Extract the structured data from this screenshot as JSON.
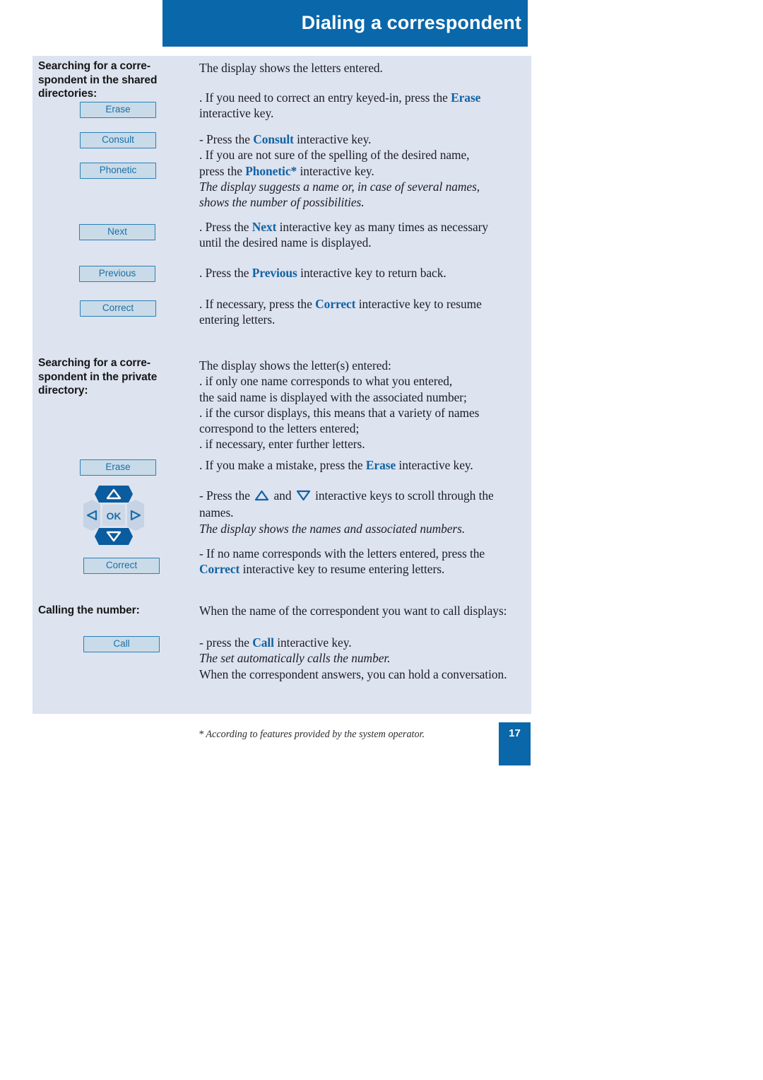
{
  "header": {
    "title": "Dialing a correspondent"
  },
  "sections": [
    {
      "id": "shared",
      "heading": "Searching for a corre-\nspondent in the shared\ndirectories:",
      "softkeys": [
        {
          "label": "Erase"
        },
        {
          "label": "Consult"
        },
        {
          "label": "Phonetic"
        },
        {
          "label": "Next"
        },
        {
          "label": "Previous"
        },
        {
          "label": "Correct"
        }
      ],
      "paragraphs": [
        {
          "id": "p1",
          "text": "The display shows the letters entered."
        },
        {
          "id": "p2a",
          "text": ". If you need to correct an entry keyed-in, press the "
        },
        {
          "id": "p2kw",
          "text": "Erase"
        },
        {
          "id": "p2b",
          "text": "interactive key."
        },
        {
          "id": "p3a",
          "text": "- Press the "
        },
        {
          "id": "p3kw",
          "text": "Consult"
        },
        {
          "id": "p3b",
          "text": " interactive key."
        },
        {
          "id": "p4a",
          "text": ". If you are not sure of the spelling of the desired name,"
        },
        {
          "id": "p4b",
          "text": "press the "
        },
        {
          "id": "p4kw",
          "text": "Phonetic*"
        },
        {
          "id": "p4c",
          "text": " interactive key."
        },
        {
          "id": "p5",
          "text": "The display suggests a name or, in case of several names,"
        },
        {
          "id": "p5b",
          "text": "shows the number of possibilities."
        },
        {
          "id": "p6a",
          "text": ". Press the "
        },
        {
          "id": "p6kw",
          "text": "Next"
        },
        {
          "id": "p6b",
          "text": " interactive key as many times as necessary"
        },
        {
          "id": "p6c",
          "text": "until the desired name is displayed."
        },
        {
          "id": "p7a",
          "text": ". Press the "
        },
        {
          "id": "p7kw",
          "text": "Previous"
        },
        {
          "id": "p7b",
          "text": " interactive key to return back."
        },
        {
          "id": "p8a",
          "text": ". If necessary, press the "
        },
        {
          "id": "p8kw",
          "text": "Correct"
        },
        {
          "id": "p8b",
          "text": " interactive key to resume"
        },
        {
          "id": "p8c",
          "text": "entering letters."
        }
      ]
    },
    {
      "id": "private",
      "heading": "Searching for a corre-\nspondent in the private\ndirectory:",
      "softkeys": [
        {
          "label": "Erase"
        },
        {
          "label": "Correct"
        }
      ],
      "navpad": {
        "ok_label": "OK"
      },
      "paragraphs": [
        {
          "id": "q1",
          "text": "The display shows the letter(s) entered:"
        },
        {
          "id": "q2",
          "text": ". if only one name corresponds to what you entered,"
        },
        {
          "id": "q3",
          "text": "the said name is displayed with the associated number;"
        },
        {
          "id": "q4",
          "text": ". if the cursor displays, this means that a variety of names"
        },
        {
          "id": "q5",
          "text": "correspond to the letters entered;"
        },
        {
          "id": "q6",
          "text": ". if necessary, enter further letters."
        },
        {
          "id": "q7a",
          "text": ". If you make a mistake, press the "
        },
        {
          "id": "q7kw",
          "text": "Erase"
        },
        {
          "id": "q7b",
          "text": " interactive key."
        },
        {
          "id": "q8a",
          "text": "- Press the "
        },
        {
          "id": "q8mid",
          "text": " and "
        },
        {
          "id": "q8b",
          "text": " interactive keys to scroll through the"
        },
        {
          "id": "q8c",
          "text": "names."
        },
        {
          "id": "q9",
          "text": "The display shows the names and associated numbers."
        },
        {
          "id": "q10a",
          "text": "- If no name corresponds with the letters entered, press the"
        },
        {
          "id": "q10kw",
          "text": "Correct"
        },
        {
          "id": "q10b",
          "text": " interactive key to resume entering letters."
        }
      ]
    },
    {
      "id": "calling",
      "heading": "Calling the number:",
      "softkeys": [
        {
          "label": "Call"
        }
      ],
      "paragraphs": [
        {
          "id": "r1",
          "text": "When the name of the correspondent you want to call displays:"
        },
        {
          "id": "r2a",
          "text": "- press the "
        },
        {
          "id": "r2kw",
          "text": "Call"
        },
        {
          "id": "r2b",
          "text": " interactive key."
        },
        {
          "id": "r3",
          "text": "The set automatically calls the number."
        },
        {
          "id": "r4",
          "text": "When the correspondent answers, you can hold a conversation."
        }
      ]
    }
  ],
  "footer": {
    "footnote": "* According to features provided by the system operator.",
    "page_number": "17"
  },
  "colors": {
    "brand_blue": "#0a67aa",
    "panel_bg": "#dde3ef",
    "key_text": "#1b6fa8",
    "key_border": "#2a7fb5",
    "key_fill": "#c9dbe8",
    "keyword": "#1162a3",
    "navpad_active": "#0a5c9e",
    "navpad_inactive": "#c6d3e4"
  }
}
